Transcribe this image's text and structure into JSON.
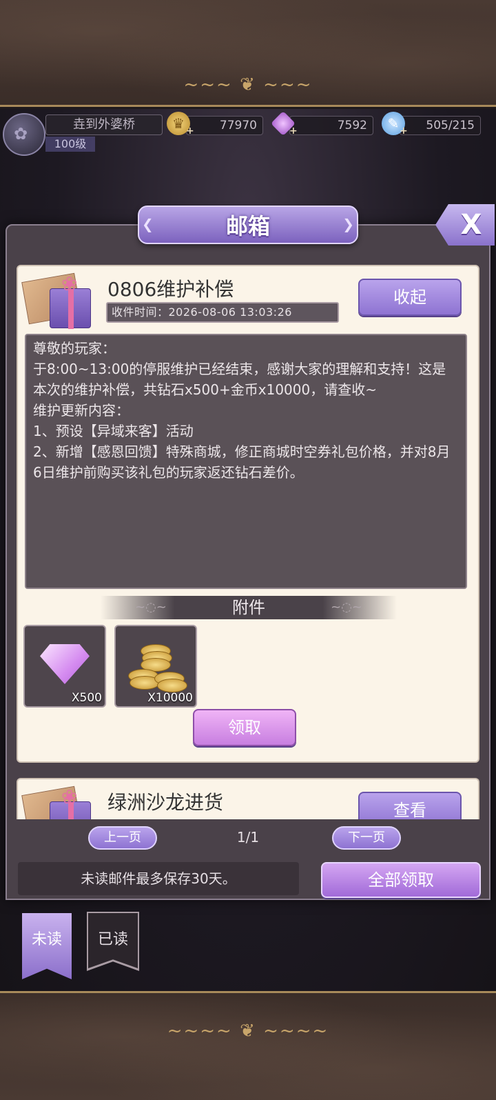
{
  "player": {
    "name": "垚到外婆桥",
    "level": "100级"
  },
  "resources": {
    "gold": "77970",
    "diamonds": "7592",
    "stamina": "505/215"
  },
  "modal": {
    "title": "邮箱",
    "close_label": "X"
  },
  "mail_open": {
    "title": "0806维护补偿",
    "received_time": "收件时间：2026-08-06 13:03:26",
    "collapse_label": "收起",
    "body": "尊敬的玩家：\n于8:00~13:00的停服维护已经结束，感谢大家的理解和支持！这是本次的维护补偿，共钻石x500+金币x10000，请查收~\n维护更新内容：\n1、预设【异域来客】活动\n2、新增【感恩回馈】特殊商城，修正商城时空券礼包价格，并对8月6日维护前购买该礼包的玩家返还钻石差价。",
    "attachments_label": "附件",
    "attachments": [
      {
        "icon": "diamond-icon",
        "qty": "X500"
      },
      {
        "icon": "gold-coins-icon",
        "qty": "X10000"
      }
    ],
    "claim_label": "领取"
  },
  "mail_next": {
    "title": "绿洲沙龙进货",
    "view_label": "查看"
  },
  "pager": {
    "prev_label": "上一页",
    "page": "1/1",
    "next_label": "下一页"
  },
  "footer": {
    "retention_note": "未读邮件最多保存30天。",
    "claim_all_label": "全部领取"
  },
  "tabs": {
    "unread": "未读",
    "read": "已读"
  },
  "colors": {
    "accent_purple": "#9a82dc",
    "card_bg": "#fbf4e8",
    "body_bg": "#5a5157"
  }
}
